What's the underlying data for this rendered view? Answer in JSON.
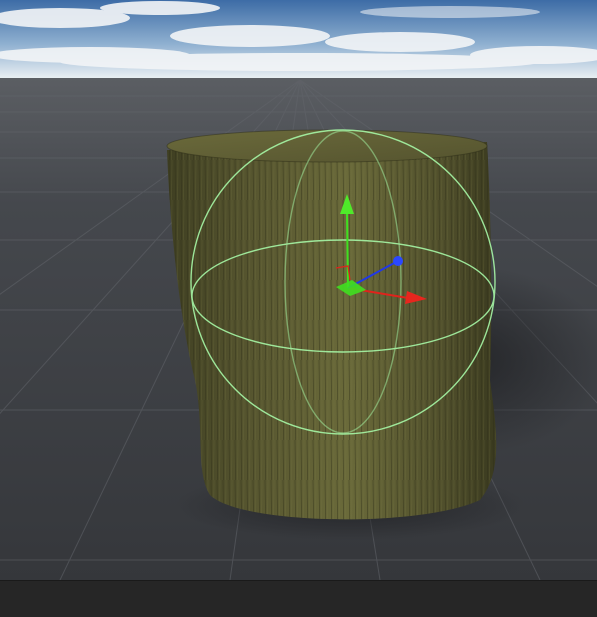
{
  "viewport": {
    "scene_object": "tree-stump",
    "gizmo": "translate-gizmo",
    "colors": {
      "sky_top": "#3f6fa9",
      "sky_horizon": "#e9eef2",
      "ground": "#3b3d42",
      "grid_line": "#5a5d63",
      "stump_bark": "#5c5b34",
      "bounds_sphere": "#9cf59c",
      "axis_x": "#e0231c",
      "axis_y": "#3fe020",
      "axis_z": "#2038e8"
    }
  },
  "bottom_bar": {
    "color": "#262626"
  }
}
